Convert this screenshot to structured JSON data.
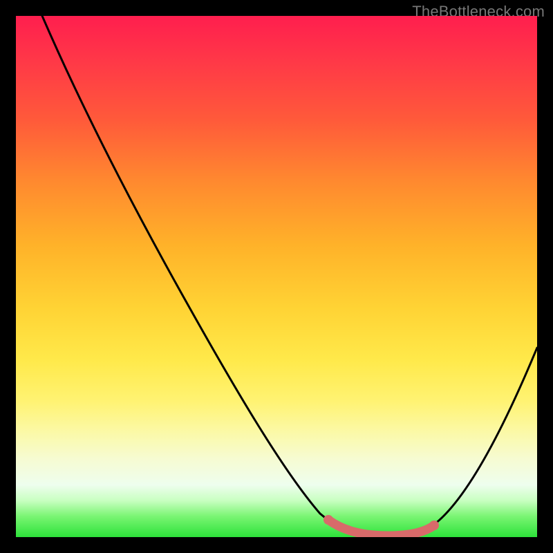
{
  "watermark": "TheBottleneck.com",
  "colors": {
    "curve": "#000000",
    "dot_highlight": "#d86a6a",
    "background_black": "#000000"
  },
  "chart_data": {
    "type": "line",
    "title": "",
    "xlabel": "",
    "ylabel": "",
    "xlim": [
      0,
      100
    ],
    "ylim": [
      0,
      100
    ],
    "grid": false,
    "series": [
      {
        "name": "bottleneck-curve",
        "x": [
          5,
          12,
          20,
          28,
          36,
          44,
          52,
          58,
          62,
          66,
          70,
          74,
          78,
          82,
          86,
          90,
          94,
          98
        ],
        "y": [
          99,
          88,
          76,
          64,
          52,
          40,
          28,
          18,
          10,
          4,
          1,
          0,
          0,
          2,
          8,
          17,
          28,
          41
        ]
      }
    ],
    "annotations": [
      {
        "name": "optimal-range-highlight",
        "type": "thick-segment",
        "x_start": 62,
        "x_end": 80,
        "y": 0.5,
        "color": "#d86a6a"
      }
    ]
  }
}
